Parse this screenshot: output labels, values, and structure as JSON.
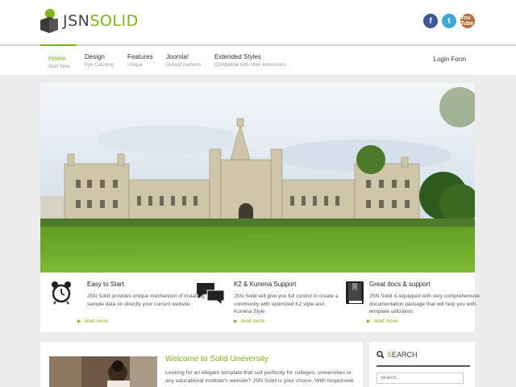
{
  "header": {
    "logo_part1": "JSN",
    "logo_part2": "SOLID",
    "social": [
      {
        "name": "facebook-icon",
        "glyph": "f"
      },
      {
        "name": "twitter-icon",
        "glyph": "t"
      },
      {
        "name": "youtube-icon",
        "glyph": "You Tube"
      }
    ]
  },
  "nav": {
    "items": [
      {
        "title": "Home",
        "sub": "Start here"
      },
      {
        "title": "Design",
        "sub": "Eye-Catching"
      },
      {
        "title": "Features",
        "sub": "Unique"
      },
      {
        "title": "Joomla!",
        "sub": "Default contents"
      },
      {
        "title": "Extended Styles",
        "sub": "Compatible with other extensions"
      }
    ],
    "login": "Login Form"
  },
  "features": [
    {
      "icon": "alarm-clock-icon",
      "title": "Easy to Start",
      "desc": "JSN Solid provides unique mechanism of installing sample data on directly your current website.",
      "more": "read more"
    },
    {
      "icon": "speech-bubbles-icon",
      "title": "K2 & Kunena Support",
      "desc": "JSN Solid will give you full control to create a community with optimized K2 style and Kunena Style",
      "more": "read more"
    },
    {
      "icon": "book-icon",
      "title": "Great docs & support",
      "desc": "JSN Solid is equipped with very comprehensive documentation package that will help you with template utilization.",
      "more": "read more"
    }
  ],
  "welcome": {
    "title": "Welcome to Solid Uneversity",
    "text": "Looking for an elegant template that suit perfectly for colleges, universities or any educational institute's website? JSN Solid is your choice. With responsive layout"
  },
  "search": {
    "title_first": "S",
    "title_rest": "EARCH",
    "placeholder": "Search..."
  },
  "colors": {
    "accent": "#7cb518",
    "dark": "#444444"
  }
}
